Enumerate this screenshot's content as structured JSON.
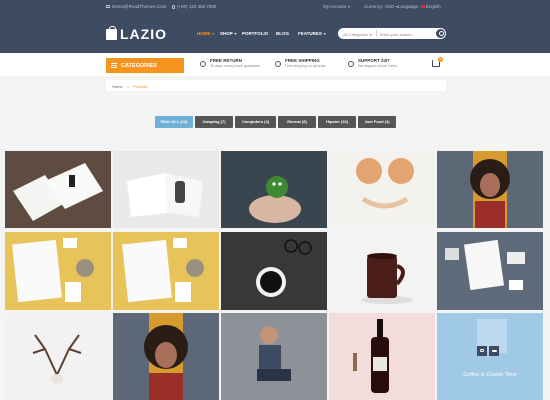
{
  "topbar": {
    "email": "Demo@RoadThemes.Com",
    "phone": "(+00) 123 456 7890",
    "account": "My Account",
    "currency_label": "Currency:",
    "currency_value": "USD",
    "language_label": "Language:",
    "language_value": "English"
  },
  "brand": {
    "name": "LAZIO"
  },
  "nav": {
    "home": "HOME",
    "shop": "SHOP",
    "portfolio": "PORTFOLIO",
    "blog": "BLOG",
    "features": "FEATURES"
  },
  "search": {
    "category": "All Categories",
    "placeholder": "Enter your search..."
  },
  "categories_label": "CATEGORIES",
  "features": [
    {
      "title": "FREE RETURN",
      "subtitle": "30 days money back guarantee"
    },
    {
      "title": "FREE SHIPPING",
      "subtitle": "Free shipping on all order"
    },
    {
      "title": "SUPPORT 24/7",
      "subtitle": "We support online 24hrs"
    }
  ],
  "cart": {
    "count": "0"
  },
  "breadcrumb": {
    "home": "Home",
    "separator": ">",
    "current": "Portfolio"
  },
  "filters": [
    {
      "label": "Filter ALL (22)",
      "active": true
    },
    {
      "label": "Camping (7)",
      "active": false
    },
    {
      "label": "Computers (4)",
      "active": false
    },
    {
      "label": "Eternal (5)",
      "active": false
    },
    {
      "label": "Hipster (10)",
      "active": false
    },
    {
      "label": "Just Food (4)",
      "active": false
    }
  ],
  "portfolio": {
    "hover_caption": "Coffee & Cookie Time"
  },
  "colors": {
    "header": "#3d4b63",
    "accent": "#f7941d",
    "filter_active": "#6fb1d6",
    "filter": "#555555",
    "background": "#f4f4f4"
  }
}
